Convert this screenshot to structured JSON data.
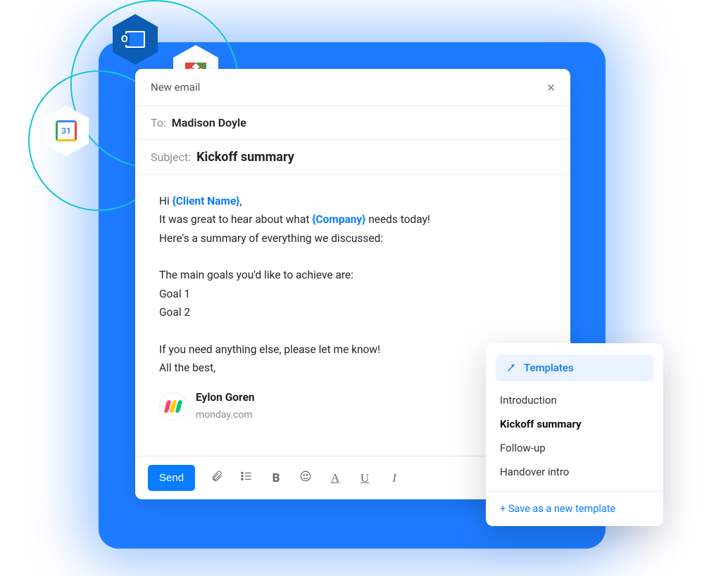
{
  "header": {
    "title": "New email"
  },
  "fields": {
    "to_label": "To:",
    "to_value": "Madison Doyle",
    "subject_label": "Subject:",
    "subject_value": "Kickoff summary"
  },
  "body": {
    "greeting_pre": "Hi ",
    "placeholder_client": "{Client Name}",
    "greeting_post": ",",
    "line_a_pre": "It was great to hear about what ",
    "placeholder_company": "{Company}",
    "line_a_post": " needs today!",
    "line_b": "Here's a summary of everything we discussed:",
    "line_goals_intro": "The main goals you'd like to achieve are:",
    "goal1": "Goal 1",
    "goal2": "Goal 2",
    "line_closing_a": "If you need anything else, please let me know!",
    "line_closing_b": "All the best,"
  },
  "signature": {
    "name": "Eylon Goren",
    "company": "monday.com"
  },
  "toolbar": {
    "send_label": "Send"
  },
  "templates": {
    "header": "Templates",
    "items": [
      {
        "label": "Introduction",
        "selected": false
      },
      {
        "label": "Kickoff summary",
        "selected": true
      },
      {
        "label": "Follow-up",
        "selected": false
      },
      {
        "label": "Handover intro",
        "selected": false
      }
    ],
    "save_label": "+ Save as a new template"
  },
  "decor": {
    "gcal_day": "31"
  }
}
